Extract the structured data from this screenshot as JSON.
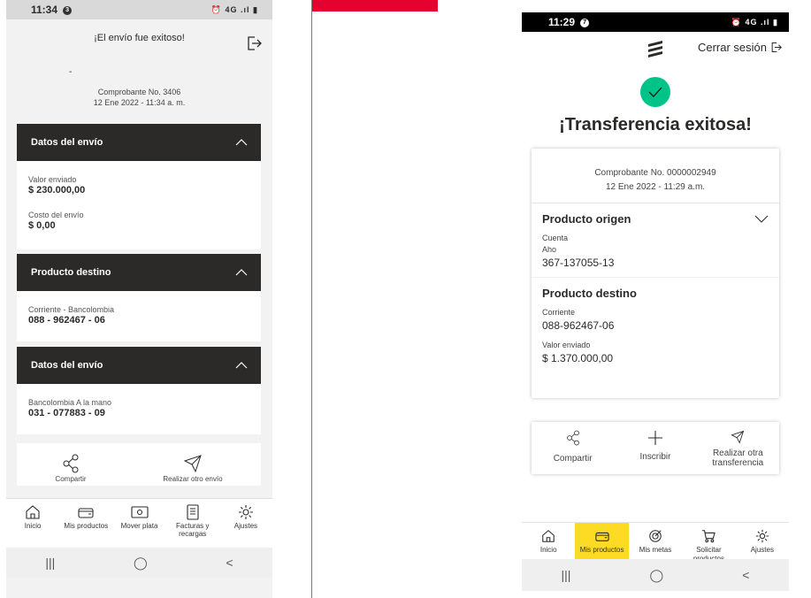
{
  "left_phone": {
    "status": {
      "time": "11:34",
      "notif_count": "3",
      "right": "⏰ 4G .ıl ▮"
    },
    "header": {
      "title": "¡El envío fue exitoso!"
    },
    "dash": "-",
    "receipt": {
      "number": "Comprobante No. 3406",
      "date": "12 Ene 2022 - 11:34 a. m."
    },
    "card1": {
      "title": "Datos del envío",
      "fields": [
        {
          "label": "Valor enviado",
          "value": "$ 230.000,00"
        },
        {
          "label": "Costo del envío",
          "value": "$ 0,00"
        }
      ]
    },
    "card2": {
      "title": "Producto destino",
      "fields": [
        {
          "label": "Corriente - Bancolombia",
          "value": "088 - 962467 - 06"
        }
      ]
    },
    "card3": {
      "title": "Datos del envío",
      "fields": [
        {
          "label": "Bancolombia A la mano",
          "value": "031 - 077883 - 09"
        }
      ]
    },
    "actions": [
      {
        "label": "Compartir",
        "icon": "share-icon"
      },
      {
        "label": "Realizar otro envío",
        "icon": "send-icon"
      }
    ],
    "nav": [
      {
        "label": "Inicio",
        "icon": "home-icon"
      },
      {
        "label": "Mis productos",
        "icon": "wallet-icon"
      },
      {
        "label": "Mover plata",
        "icon": "money-icon"
      },
      {
        "label": "Facturas y recargas",
        "icon": "invoice-icon"
      },
      {
        "label": "Ajustes",
        "icon": "gear-icon"
      }
    ],
    "system": {
      "recents": "|||",
      "home": "◯",
      "back": "<"
    }
  },
  "accent": {
    "red": "#e4032e",
    "yellow": "#fdda24",
    "green": "#00c389",
    "dark": "#2c2a29"
  },
  "right_phone": {
    "status": {
      "time": "11:29",
      "notif_count": "7",
      "right": "⏰ 4G .ıl ▮"
    },
    "logout": "Cerrar sesión",
    "title": "¡Transferencia exitosa!",
    "receipt": {
      "number": "Comprobante No. 0000002949",
      "date": "12 Ene 2022 - 11:29 a.m."
    },
    "origin": {
      "title": "Producto origen",
      "label1": "Cuenta",
      "label2": "Aho",
      "value": "367-137055-13"
    },
    "destination": {
      "title": "Producto destino",
      "type": "Corriente",
      "account": "088-962467-06",
      "amount_label": "Valor enviado",
      "amount": "$ 1.370.000,00"
    },
    "actions": [
      {
        "label": "Compartir",
        "icon": "share-icon"
      },
      {
        "label": "Inscribir",
        "icon": "plus-icon"
      },
      {
        "label": "Realizar otra transferencia",
        "icon": "send-icon"
      }
    ],
    "nav": [
      {
        "label": "Inicio",
        "icon": "home-icon"
      },
      {
        "label": "Mis productos",
        "icon": "wallet-icon",
        "active": true
      },
      {
        "label": "Mis metas",
        "icon": "target-icon"
      },
      {
        "label": "Solicitar productos",
        "icon": "cart-icon"
      },
      {
        "label": "Ajustes",
        "icon": "gear-icon"
      }
    ],
    "system": {
      "recents": "|||",
      "home": "◯",
      "back": "<"
    }
  }
}
